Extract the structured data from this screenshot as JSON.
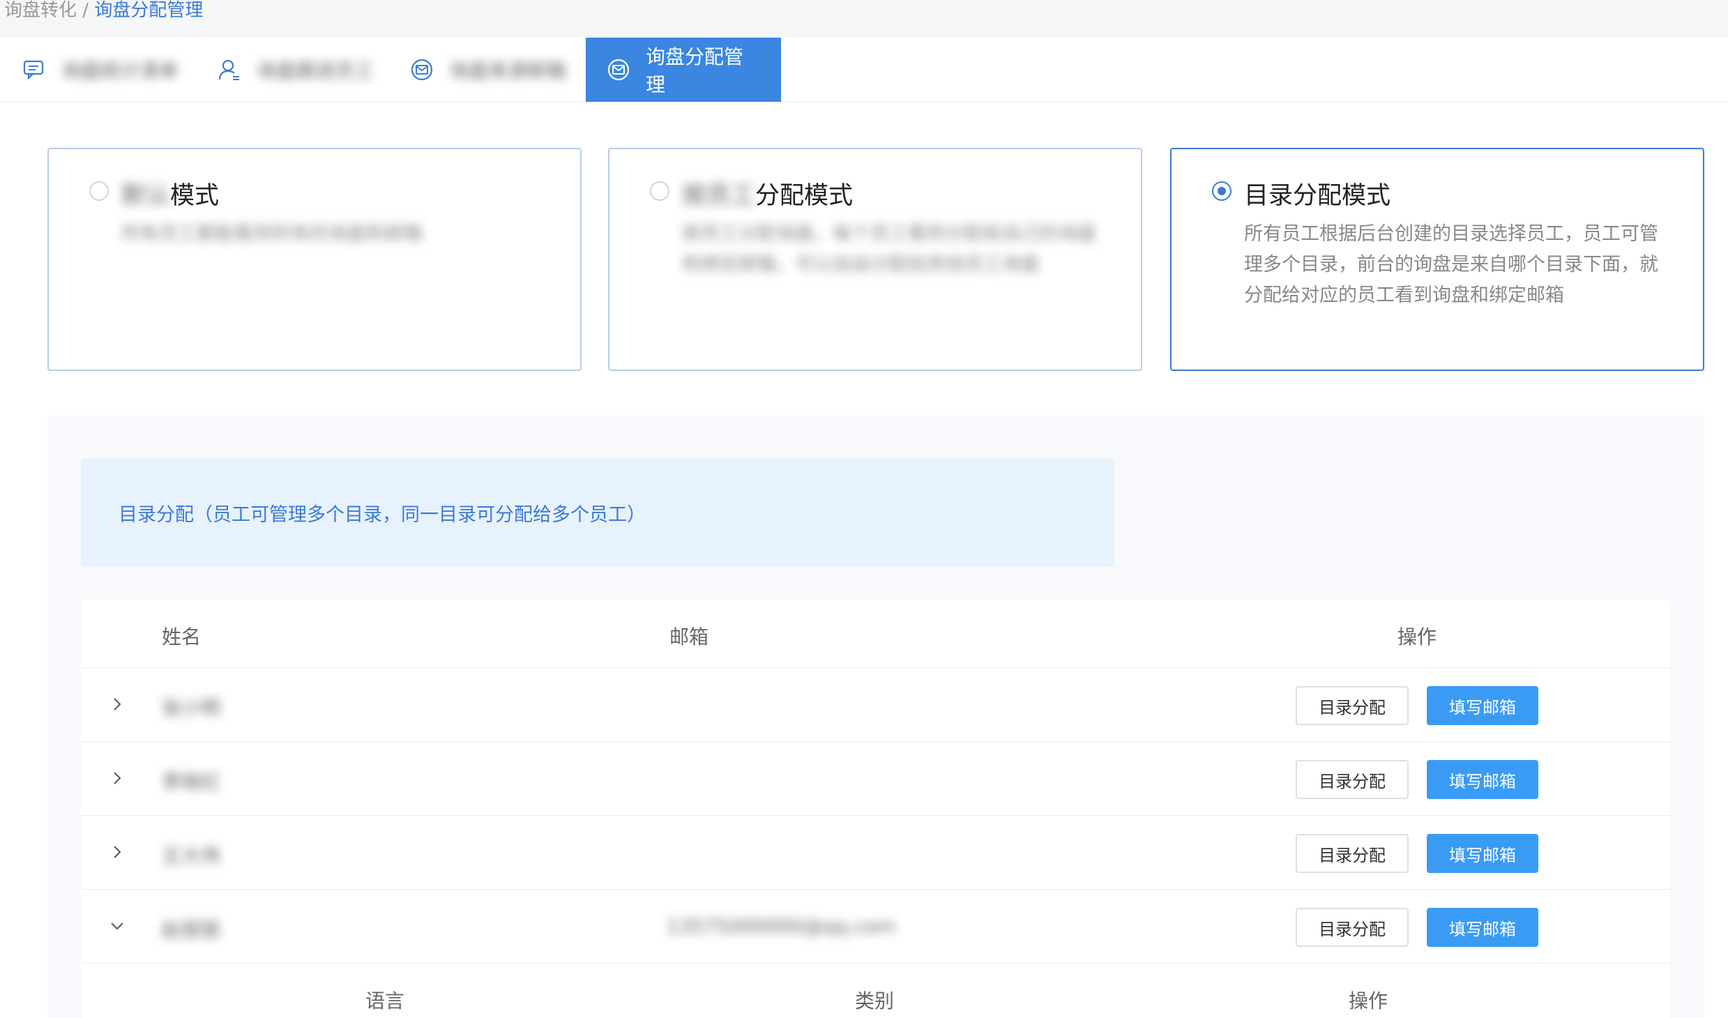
{
  "breadcrumb": {
    "parent": "询盘转化",
    "separator": " / ",
    "current": "询盘分配管理"
  },
  "tabs": [
    {
      "label": "询盘统计清单",
      "icon": "chat-icon"
    },
    {
      "label": "询盘跟进员工",
      "icon": "user-icon"
    },
    {
      "label": "询盘来源邮箱",
      "icon": "mail-icon"
    },
    {
      "label": "询盘分配管理",
      "icon": "mail-icon"
    }
  ],
  "modes": [
    {
      "title_blur": "默认",
      "title": "模式",
      "desc": "所有员工都能看到所有的询盘和邮箱",
      "selected": false
    },
    {
      "title_blur": "按员工",
      "title": "分配模式",
      "desc": "按员工分配询盘，每个员工看到分配给自己的询盘和绑定邮箱，可以自由分配给其他员工询盘",
      "selected": false
    },
    {
      "title": "目录分配模式",
      "desc": "所有员工根据后台创建的目录选择员工，员工可管理多个目录，前台的询盘是来自哪个目录下面，就分配给对应的员工看到询盘和绑定邮箱",
      "selected": true
    }
  ],
  "notice": "目录分配（员工可管理多个目录，同一目录可分配给多个员工）",
  "table": {
    "headers": {
      "name": "姓名",
      "email": "邮箱",
      "action": "操作"
    },
    "rows": [
      {
        "name": "张小明",
        "email": "",
        "expanded": false
      },
      {
        "name": "李晓红",
        "email": "",
        "expanded": false
      },
      {
        "name": "王大伟",
        "email": "",
        "expanded": false
      },
      {
        "name": "赵丽丽",
        "email": "13575000000@qq.com",
        "expanded": true
      }
    ],
    "buttons": {
      "assign": "目录分配",
      "fill_email": "填写邮箱"
    },
    "subheaders": {
      "language": "语言",
      "category": "类别",
      "action": "操作"
    }
  },
  "colors": {
    "primary": "#3a86e0",
    "button": "#3a9bf5",
    "link": "#3a7bd5"
  }
}
